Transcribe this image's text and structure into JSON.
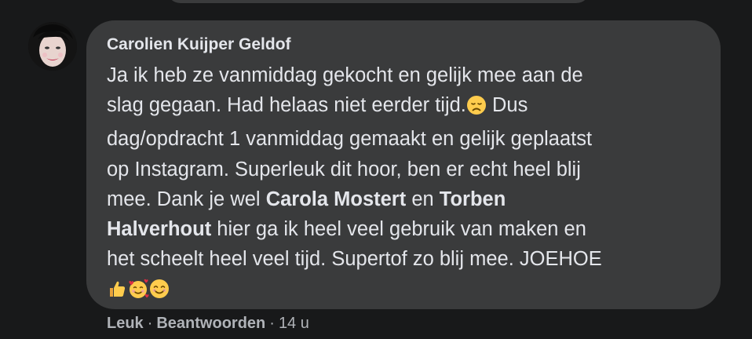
{
  "comment": {
    "author": "Carolien Kuijper Geldof",
    "lines": [
      {
        "text": "Ja ik heb ze vanmiddag gekocht en gelijk mee aan de"
      },
      {
        "text": "slag gegaan. Had helaas niet eerder tijd.",
        "after": "Dus"
      },
      {
        "text": "dag/opdracht 1 vanmiddag gemaakt en gelijk geplaatst"
      },
      {
        "text": "op Instagram. Superleuk dit hoor, ben er echt heel blij"
      },
      {
        "pre": "mee. Dank je wel",
        "mention": "Carola Mostert",
        "mid": "en",
        "mention2": "Torben"
      },
      {
        "mention": "Halverhout",
        "post": "hier ga ik heel veel gebruik van maken en"
      },
      {
        "text": "het scheelt heel veel tijd. Supertof zo blij mee. JOEHOE"
      }
    ],
    "emojis": {
      "disappointed": "disappointed-face-emoji",
      "thumbs_up": "thumbs-up-emoji",
      "hearts": "smiling-face-with-hearts-emoji",
      "smile": "smiling-face-emoji"
    }
  },
  "actions": {
    "like": "Leuk",
    "reply": "Beantwoorden",
    "separator": "·",
    "time": "14 u"
  },
  "colors": {
    "page_bg": "#18191a",
    "bubble_bg": "#3a3b3c",
    "text": "#e4e6eb",
    "meta": "#b0b3b8",
    "emoji_yellow": "#ffcc4d"
  }
}
